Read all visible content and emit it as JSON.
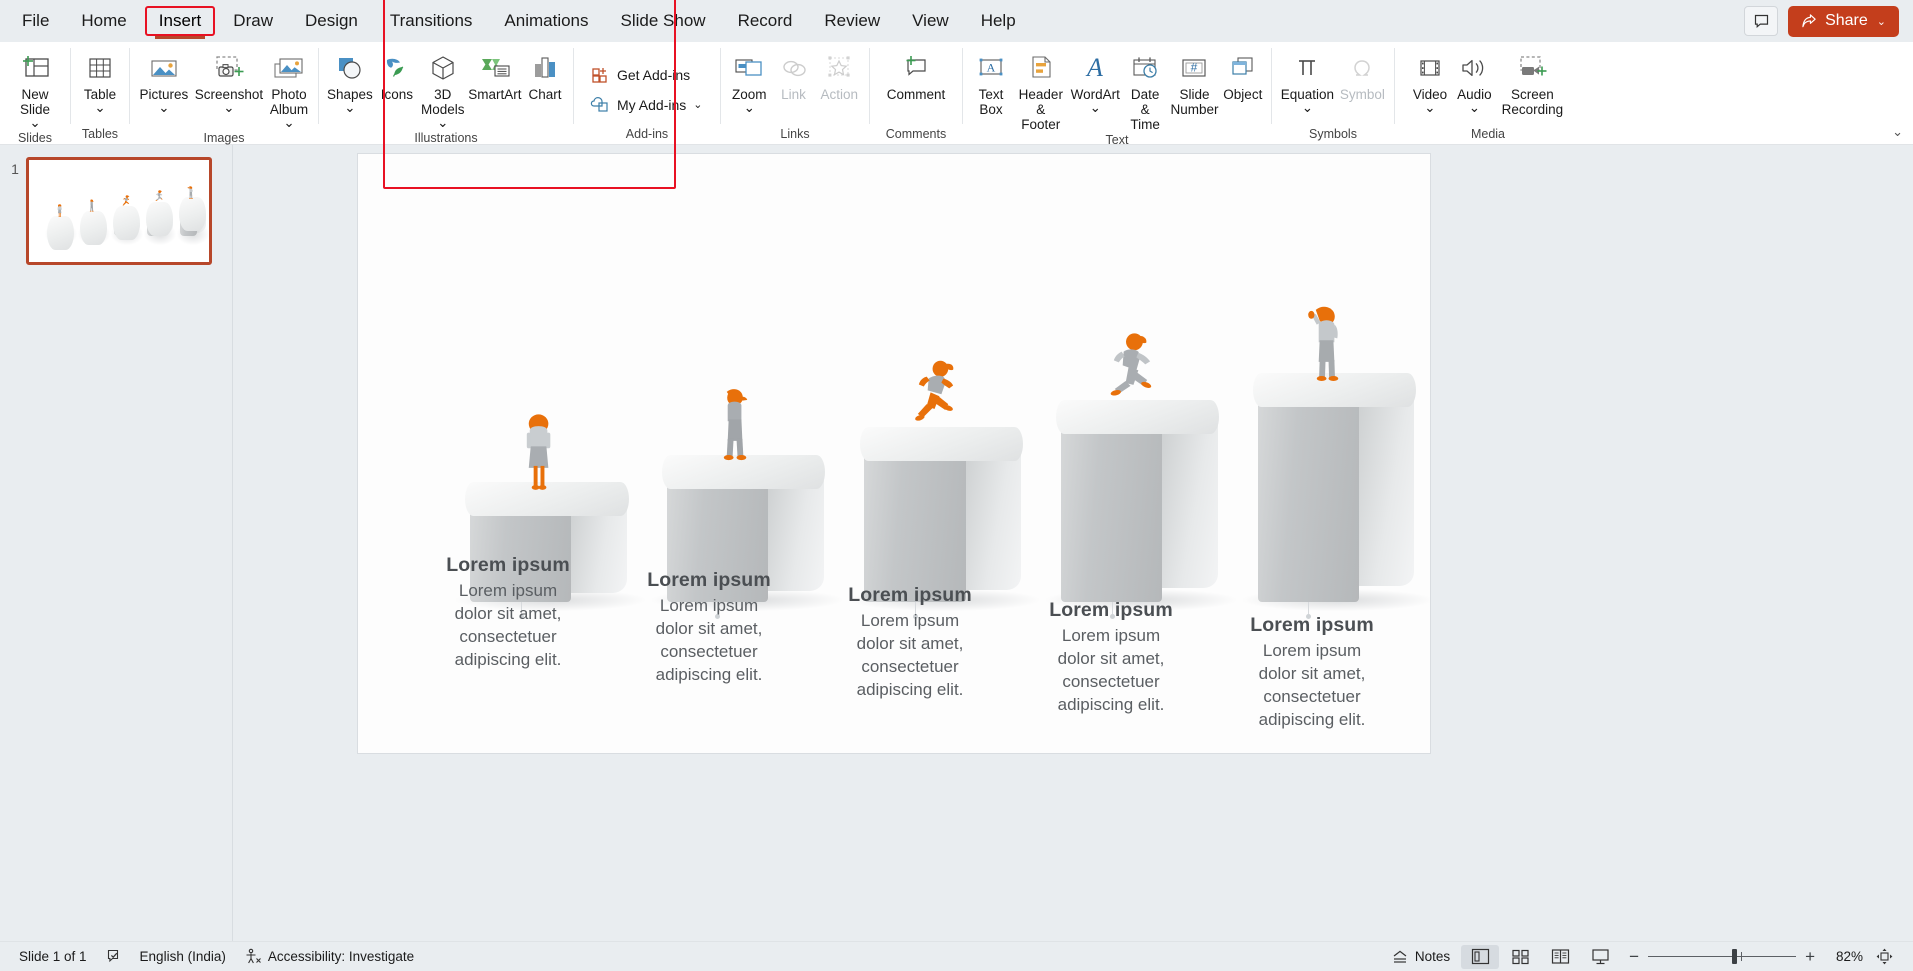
{
  "window": {
    "app": "PowerPoint",
    "comment_icon": "comment-icon",
    "share_label": "Share",
    "share_caret": "⌄"
  },
  "tabs": [
    {
      "label": "File",
      "active": false
    },
    {
      "label": "Home",
      "active": false
    },
    {
      "label": "Insert",
      "active": true
    },
    {
      "label": "Draw",
      "active": false
    },
    {
      "label": "Design",
      "active": false
    },
    {
      "label": "Transitions",
      "active": false
    },
    {
      "label": "Animations",
      "active": false
    },
    {
      "label": "Slide Show",
      "active": false
    },
    {
      "label": "Record",
      "active": false
    },
    {
      "label": "Review",
      "active": false
    },
    {
      "label": "View",
      "active": false
    },
    {
      "label": "Help",
      "active": false
    }
  ],
  "ribbon": {
    "highlighted_group": "Illustrations",
    "collapse_caret": "⌄",
    "groups": [
      {
        "name": "Slides",
        "label": "Slides",
        "items": [
          {
            "label": "New\nSlide",
            "icon": "new-slide-icon",
            "dropdown": true,
            "disabled": false
          }
        ]
      },
      {
        "name": "Tables",
        "label": "Tables",
        "items": [
          {
            "label": "Table",
            "icon": "table-icon",
            "dropdown": true,
            "disabled": false
          }
        ]
      },
      {
        "name": "Images",
        "label": "Images",
        "items": [
          {
            "label": "Pictures",
            "icon": "pictures-icon",
            "dropdown": true,
            "disabled": false
          },
          {
            "label": "Screenshot",
            "icon": "screenshot-icon",
            "dropdown": true,
            "disabled": false
          },
          {
            "label": "Photo\nAlbum",
            "icon": "photo-album-icon",
            "dropdown": true,
            "disabled": false
          }
        ]
      },
      {
        "name": "Illustrations",
        "label": "Illustrations",
        "items": [
          {
            "label": "Shapes",
            "icon": "shapes-icon",
            "dropdown": true,
            "disabled": false
          },
          {
            "label": "Icons",
            "icon": "icons-icon",
            "dropdown": false,
            "disabled": false
          },
          {
            "label": "3D\nModels",
            "icon": "3d-models-icon",
            "dropdown": true,
            "disabled": false
          },
          {
            "label": "SmartArt",
            "icon": "smartart-icon",
            "dropdown": false,
            "disabled": false
          },
          {
            "label": "Chart",
            "icon": "chart-icon",
            "dropdown": false,
            "disabled": false
          }
        ]
      },
      {
        "name": "Add-ins",
        "label": "Add-ins",
        "items": [
          {
            "label": "Get Add-ins",
            "icon": "get-addins-icon",
            "dropdown": false,
            "disabled": false
          },
          {
            "label": "My Add-ins",
            "icon": "my-addins-icon",
            "dropdown": true,
            "disabled": false
          }
        ]
      },
      {
        "name": "Links",
        "label": "Links",
        "items": [
          {
            "label": "Zoom",
            "icon": "zoom-icon",
            "dropdown": true,
            "disabled": false
          },
          {
            "label": "Link",
            "icon": "link-icon",
            "dropdown": false,
            "disabled": true
          },
          {
            "label": "Action",
            "icon": "action-icon",
            "dropdown": false,
            "disabled": true
          }
        ]
      },
      {
        "name": "Comments",
        "label": "Comments",
        "items": [
          {
            "label": "Comment",
            "icon": "comment-add-icon",
            "dropdown": false,
            "disabled": false
          }
        ]
      },
      {
        "name": "Text",
        "label": "Text",
        "items": [
          {
            "label": "Text\nBox",
            "icon": "text-box-icon",
            "dropdown": false,
            "disabled": false
          },
          {
            "label": "Header\n& Footer",
            "icon": "header-footer-icon",
            "dropdown": false,
            "disabled": false
          },
          {
            "label": "WordArt",
            "icon": "wordart-icon",
            "dropdown": true,
            "disabled": false
          },
          {
            "label": "Date &\nTime",
            "icon": "date-time-icon",
            "dropdown": false,
            "disabled": false
          },
          {
            "label": "Slide\nNumber",
            "icon": "slide-number-icon",
            "dropdown": false,
            "disabled": false
          },
          {
            "label": "Object",
            "icon": "object-icon",
            "dropdown": false,
            "disabled": false
          }
        ]
      },
      {
        "name": "Symbols",
        "label": "Symbols",
        "items": [
          {
            "label": "Equation",
            "icon": "equation-icon",
            "dropdown": true,
            "disabled": false
          },
          {
            "label": "Symbol",
            "icon": "symbol-icon",
            "dropdown": false,
            "disabled": true
          }
        ]
      },
      {
        "name": "Media",
        "label": "Media",
        "items": [
          {
            "label": "Video",
            "icon": "video-icon",
            "dropdown": true,
            "disabled": false
          },
          {
            "label": "Audio",
            "icon": "audio-icon",
            "dropdown": true,
            "disabled": false
          },
          {
            "label": "Screen\nRecording",
            "icon": "screen-recording-icon",
            "dropdown": false,
            "disabled": false
          }
        ]
      }
    ]
  },
  "thumbnails": [
    {
      "number": "1",
      "selected": true
    }
  ],
  "slide": {
    "columns": [
      {
        "title": "Lorem ipsum",
        "body": "Lorem ipsum\ndolor sit amet,\nconsectetuer\nadipiscing elit."
      },
      {
        "title": "Lorem ipsum",
        "body": "Lorem ipsum\ndolor sit amet,\nconsectetuer\nadipiscing elit."
      },
      {
        "title": "Lorem ipsum",
        "body": "Lorem ipsum\ndolor sit amet,\nconsectetuer\nadipiscing elit."
      },
      {
        "title": "Lorem ipsum",
        "body": "Lorem ipsum\ndolor sit amet,\nconsectetuer\nadipiscing elit."
      },
      {
        "title": "Lorem ipsum",
        "body": "Lorem ipsum\ndolor sit amet,\nconsectetuer\nadipiscing elit."
      }
    ],
    "accent_color": "#e8700a",
    "figure_color": "#a9adb1"
  },
  "statusbar": {
    "slide_count": "Slide 1 of 1",
    "spellcheck_icon": "spellcheck-icon",
    "language": "English (India)",
    "accessibility_icon": "accessibility-icon",
    "accessibility": "Accessibility: Investigate",
    "notes_label": "Notes",
    "views": [
      {
        "name": "normal-view",
        "icon": "normal-view-icon",
        "active": true
      },
      {
        "name": "slide-sorter-view",
        "icon": "slide-sorter-icon",
        "active": false
      },
      {
        "name": "reading-view",
        "icon": "reading-view-icon",
        "active": false
      },
      {
        "name": "slide-show-view",
        "icon": "slide-show-icon",
        "active": false
      }
    ],
    "zoom_out": "−",
    "zoom_in": "+",
    "zoom_level": "82%",
    "fit_icon": "fit-slide-icon"
  }
}
